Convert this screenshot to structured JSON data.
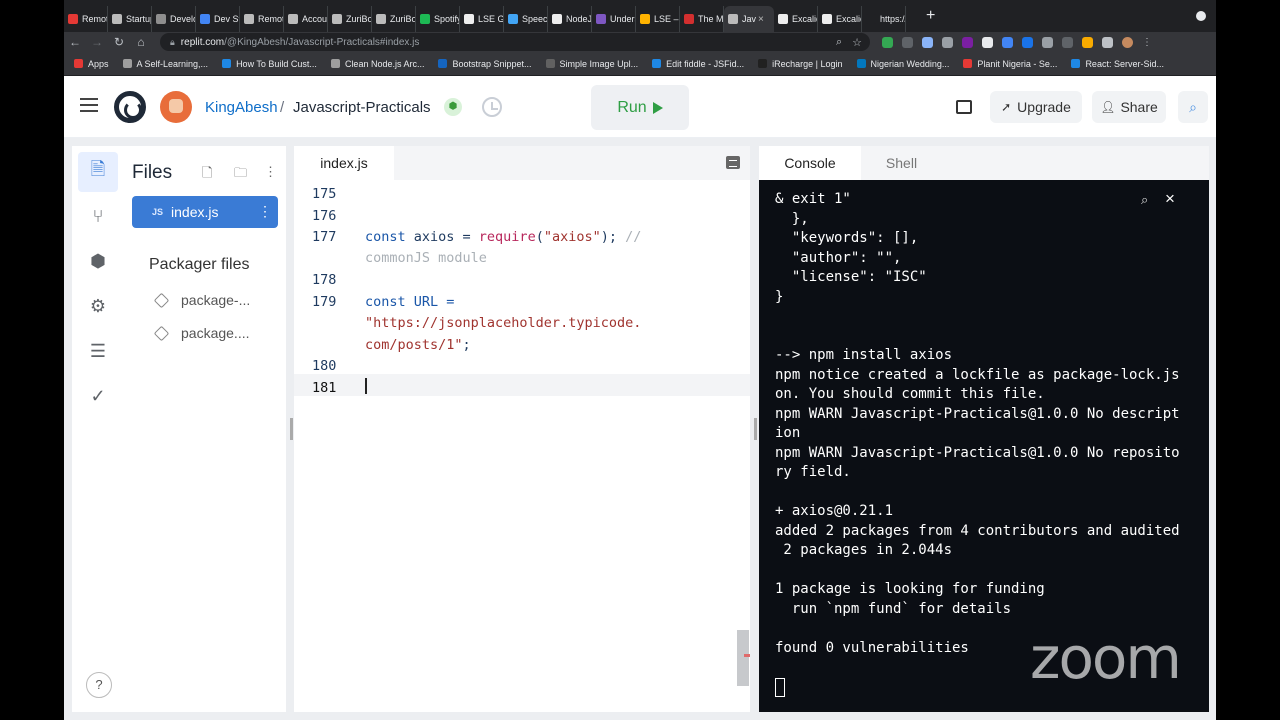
{
  "browser": {
    "tabs": [
      {
        "label": "Remote",
        "color": "#e53935"
      },
      {
        "label": "Startup",
        "color": "#bbbbbb"
      },
      {
        "label": "Develo",
        "color": "#8e8e8e"
      },
      {
        "label": "Dev St",
        "color": "#4285f4"
      },
      {
        "label": "Remote",
        "color": "#bbbbbb"
      },
      {
        "label": "Accoun",
        "color": "#bbbbbb"
      },
      {
        "label": "ZuriBo",
        "color": "#bbbbbb"
      },
      {
        "label": "ZuriBo",
        "color": "#bbbbbb"
      },
      {
        "label": "Spotify",
        "color": "#1db954"
      },
      {
        "label": "LSE Ge",
        "color": "#eeeeee"
      },
      {
        "label": "SpeechN",
        "color": "#42a5f5"
      },
      {
        "label": "NodeJ",
        "color": "#eeeeee"
      },
      {
        "label": "Unders",
        "color": "#7e57c2"
      },
      {
        "label": "LSE – F",
        "color": "#ffb300"
      },
      {
        "label": "The Mo",
        "color": "#d32f2f"
      },
      {
        "label": "Jav",
        "color": "#bbbbbb",
        "active": true
      },
      {
        "label": "Excalid",
        "color": "#eeeeee"
      },
      {
        "label": "Excalid",
        "color": "#eeeeee"
      },
      {
        "label": "https://",
        "color": "#202124"
      }
    ],
    "url_host": "replit.com",
    "url_path": "/@KingAbesh/Javascript-Practicals#index.js",
    "bookmarks": [
      {
        "label": "Apps",
        "color": "#e53935"
      },
      {
        "label": "A Self-Learning,...",
        "color": "#9e9e9e"
      },
      {
        "label": "How To Build Cust...",
        "color": "#1e88e5"
      },
      {
        "label": "Clean Node.js Arc...",
        "color": "#9e9e9e"
      },
      {
        "label": "Bootstrap Snippet...",
        "color": "#1565c0"
      },
      {
        "label": "Simple Image Upl...",
        "color": "#616161"
      },
      {
        "label": "Edit fiddle - JSFid...",
        "color": "#1e88e5"
      },
      {
        "label": "iRecharge | Login",
        "color": "#212121"
      },
      {
        "label": "Nigerian Wedding...",
        "color": "#0277bd"
      },
      {
        "label": "Planit Nigeria - Se...",
        "color": "#e53935"
      },
      {
        "label": "React: Server-Sid...",
        "color": "#1e88e5"
      }
    ]
  },
  "header": {
    "user": "KingAbesh",
    "separator": "/",
    "repl_name": "Javascript-Practicals",
    "run_label": "Run",
    "upgrade_label": "Upgrade",
    "share_label": "Share"
  },
  "files": {
    "title": "Files",
    "active_file": "index.js",
    "active_file_badge": "JS",
    "packager_title": "Packager files",
    "packager_files": [
      "package-...",
      "package...."
    ]
  },
  "editor": {
    "tab": "index.js",
    "lines": [
      {
        "num": "175",
        "code": ""
      },
      {
        "num": "176",
        "code": ""
      },
      {
        "num": "177",
        "kw": "const",
        "rest": " axios = ",
        "fn": "require",
        "open": "(",
        "str": "\"axios\"",
        "close": "); ",
        "comment": "//",
        "wrap": "commonJS module"
      },
      {
        "num": "178",
        "code": ""
      },
      {
        "num": "179",
        "kw": "const",
        "rest": " URL =",
        "str_wrap1": "\"https://jsonplaceholder.typicode.",
        "str_wrap2": "com/posts/1\"",
        "end": ";"
      },
      {
        "num": "180",
        "code": ""
      },
      {
        "num": "181",
        "code": ""
      }
    ]
  },
  "console": {
    "tab_console": "Console",
    "tab_shell": "Shell",
    "output": "& exit 1\"\n  },\n  \"keywords\": [],\n  \"author\": \"\",\n  \"license\": \"ISC\"\n}\n\n\n--> npm install axios\nnpm notice created a lockfile as package-lock.js\non. You should commit this file.\nnpm WARN Javascript-Practicals@1.0.0 No descript\nion\nnpm WARN Javascript-Practicals@1.0.0 No reposito\nry field.\n\n+ axios@0.21.1\nadded 2 packages from 4 contributors and audited\n 2 packages in 2.044s\n\n1 package is looking for funding\n  run `npm fund` for details\n\nfound 0 vulnerabilities"
  },
  "overlay": {
    "watermark": "zoom"
  }
}
